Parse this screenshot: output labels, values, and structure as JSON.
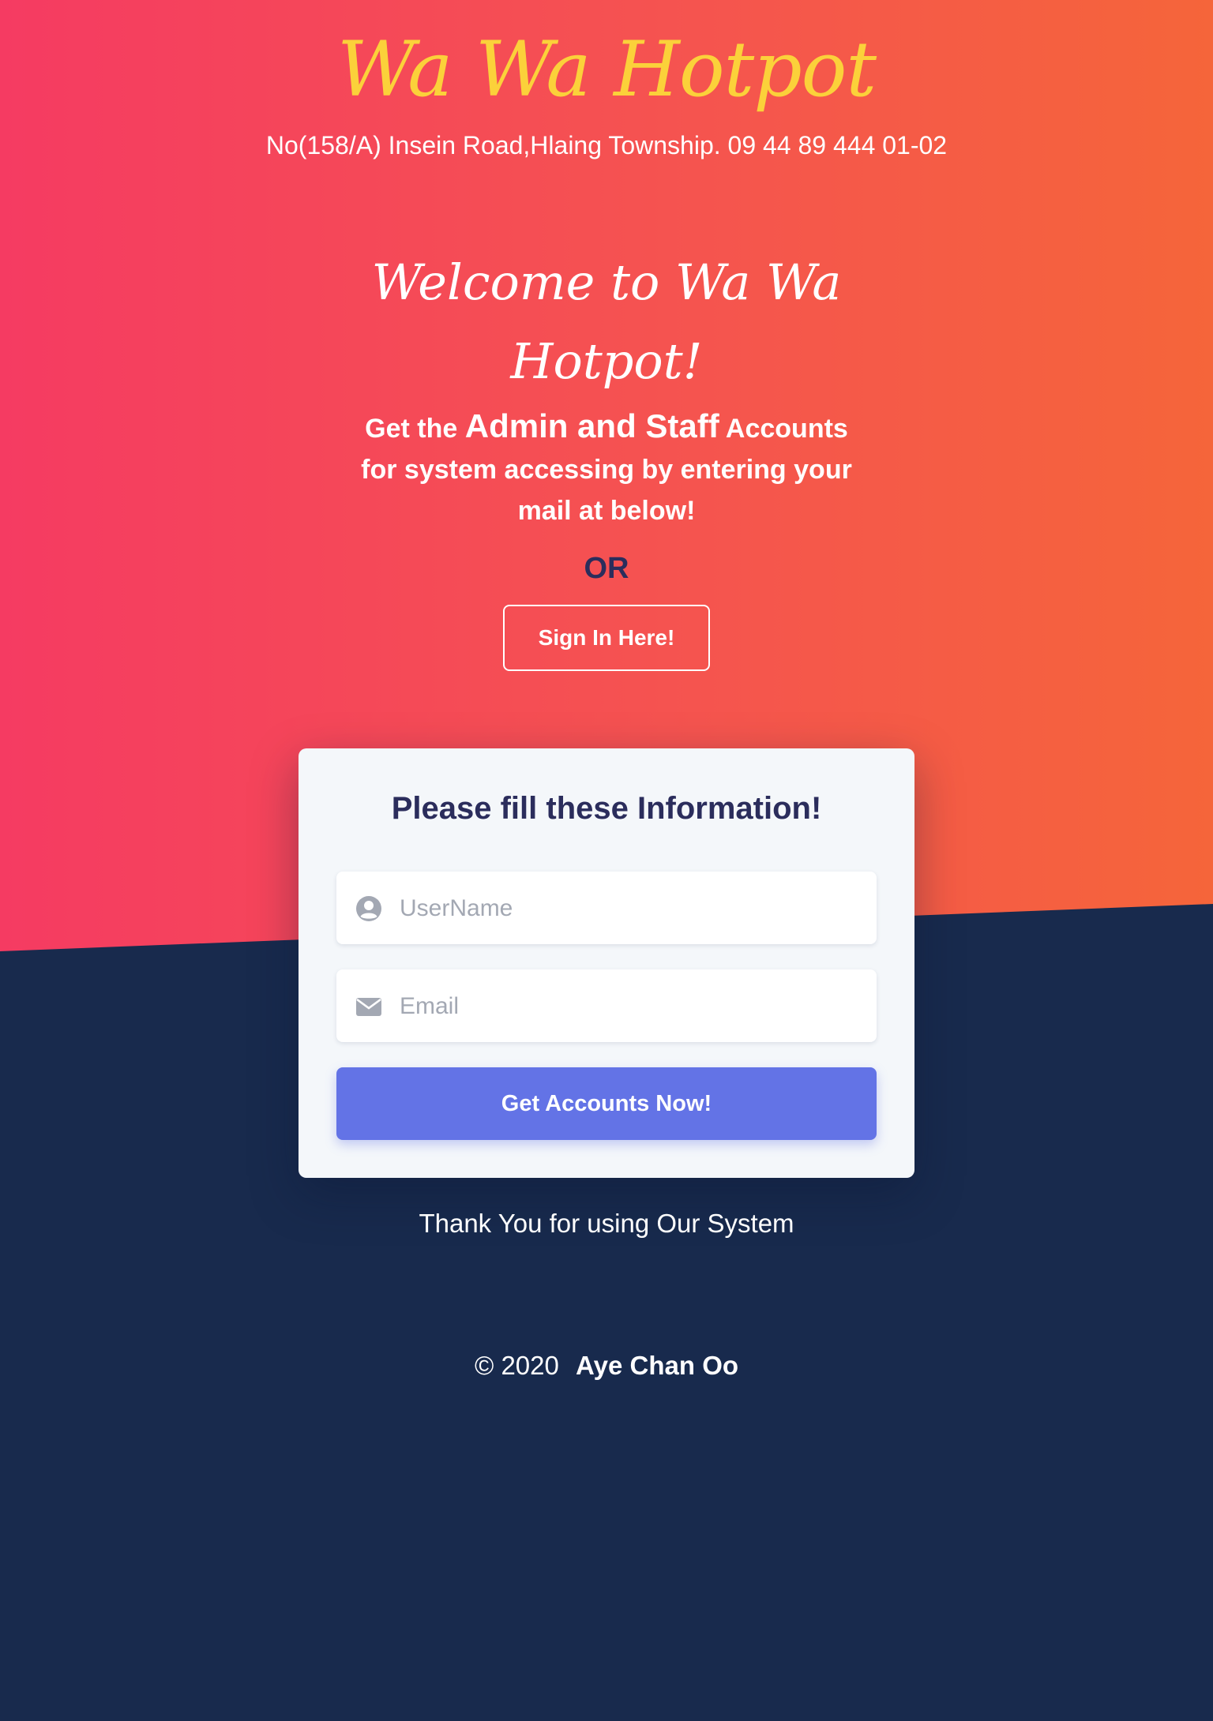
{
  "header": {
    "brand": "Wa Wa Hotpot",
    "address": "No(158/A) Insein Road,Hlaing Township. 09 44 89 444 01-02"
  },
  "hero": {
    "welcome": "Welcome to Wa Wa Hotpot!",
    "intro_before": "Get the ",
    "intro_emphasis": "Admin and Staff",
    "intro_after": " Accounts for system accessing by entering your mail at below!",
    "or": "OR",
    "signin_label": "Sign In Here!"
  },
  "form": {
    "title": "Please fill these Information!",
    "username_placeholder": "UserName",
    "username_value": "",
    "email_placeholder": "Email",
    "email_value": "",
    "submit_label": "Get Accounts Now!"
  },
  "thanks": "Thank You for using Our System",
  "footer": {
    "copyright": "© 2020",
    "author": "Aye Chan Oo"
  },
  "icons": {
    "username": "user-circle-icon",
    "email": "envelope-icon"
  },
  "colors": {
    "brand": "#fbd13a",
    "gradient_start": "#f53b62",
    "gradient_end": "#f5653a",
    "dark_bg": "#182a4d",
    "accent_button": "#6373e6",
    "heading_dark": "#2b2d5c"
  }
}
